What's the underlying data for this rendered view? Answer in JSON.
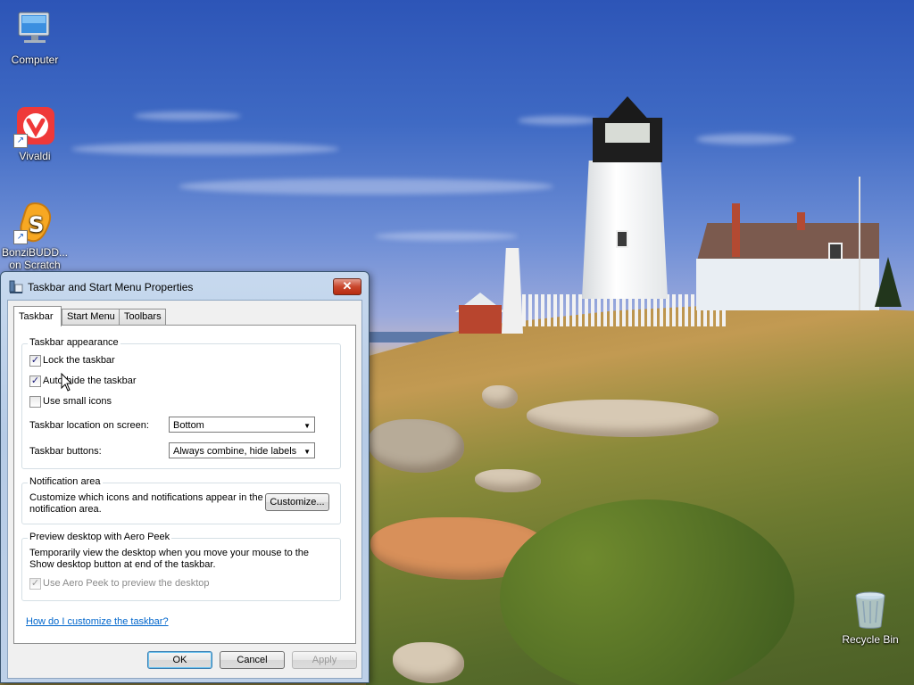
{
  "desktop": {
    "icons": [
      {
        "label": "Computer",
        "icon": "computer-icon"
      },
      {
        "label": "Vivaldi",
        "icon": "vivaldi-icon"
      },
      {
        "label_line1": "BonziBUDD...",
        "label_line2": "on Scratch",
        "icon": "scratch-icon"
      },
      {
        "label": "Recycle Bin",
        "icon": "recycle-bin-icon"
      }
    ]
  },
  "dialog": {
    "title": "Taskbar and Start Menu Properties",
    "close_glyph": "✕",
    "tabs": [
      {
        "label": "Taskbar",
        "active": true
      },
      {
        "label": "Start Menu",
        "active": false
      },
      {
        "label": "Toolbars",
        "active": false
      }
    ],
    "appearance": {
      "title": "Taskbar appearance",
      "lock": {
        "label": "Lock the taskbar",
        "checked": true
      },
      "autohide": {
        "label": "Auto-hide the taskbar",
        "checked": true
      },
      "small_icons": {
        "label": "Use small icons",
        "checked": false
      },
      "location_label": "Taskbar location on screen:",
      "location_value": "Bottom",
      "buttons_label": "Taskbar buttons:",
      "buttons_value": "Always combine, hide labels"
    },
    "notification": {
      "title": "Notification area",
      "text_line1": "Customize which icons and notifications appear in the",
      "text_line2": "notification area.",
      "button": "Customize..."
    },
    "aero_peek": {
      "title": "Preview desktop with Aero Peek",
      "text_line1": "Temporarily view the desktop when you move your mouse to the",
      "text_line2": "Show desktop button at end of the taskbar.",
      "checkbox": {
        "label": "Use Aero Peek to preview the desktop",
        "checked": true,
        "disabled": true
      }
    },
    "help_link": "How do I customize the taskbar?",
    "buttons": {
      "ok": "OK",
      "cancel": "Cancel",
      "apply": "Apply"
    },
    "check_glyph": "✓"
  },
  "colors": {
    "link": "#0066cc",
    "close_button": "#c9462c",
    "default_button_border": "#3c7fb1"
  }
}
